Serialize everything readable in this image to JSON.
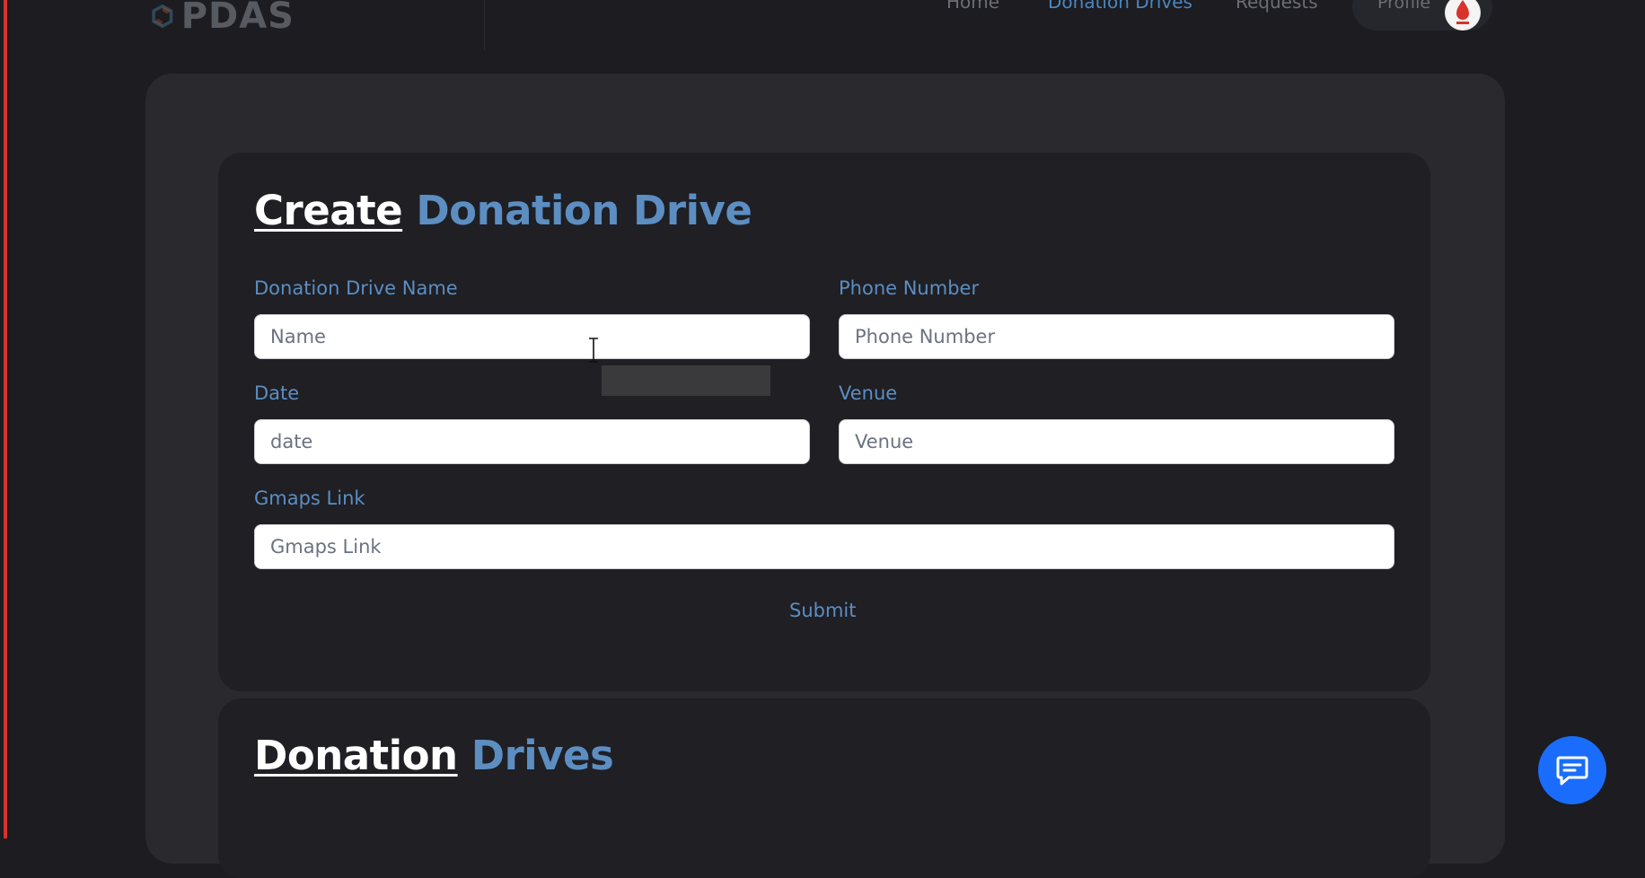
{
  "brand": {
    "logo_text": "PDAS"
  },
  "nav": {
    "links": [
      {
        "label": "Home",
        "active": false
      },
      {
        "label": "Donation Drives",
        "active": true
      },
      {
        "label": "Requests",
        "active": false
      }
    ],
    "profile_label": "Profile"
  },
  "create_section": {
    "title_part1": "Create",
    "title_part2": "Donation Drive",
    "fields": {
      "name": {
        "label": "Donation Drive Name",
        "placeholder": "Name",
        "value": ""
      },
      "phone": {
        "label": "Phone Number",
        "placeholder": "Phone Number",
        "value": ""
      },
      "date": {
        "label": "Date",
        "placeholder": "date",
        "value": ""
      },
      "venue": {
        "label": "Venue",
        "placeholder": "Venue",
        "value": ""
      },
      "gmaps": {
        "label": "Gmaps Link",
        "placeholder": "Gmaps Link",
        "value": ""
      }
    },
    "submit_label": "Submit"
  },
  "drives_section": {
    "title_part1": "Donation",
    "title_part2": "Drives"
  },
  "colors": {
    "background": "#1c1c21",
    "card": "#29292e",
    "inner_card": "#1f1f24",
    "accent_blue": "#5c8ec2",
    "nav_active": "#4c86c0",
    "chat_button": "#1a6dfc",
    "left_edge": "#d8322c"
  },
  "icons": {
    "logo": "pdas-logo-icon",
    "avatar": "profile-avatar-icon",
    "chat": "chat-bubble-icon",
    "cursor": "text-cursor-icon"
  }
}
